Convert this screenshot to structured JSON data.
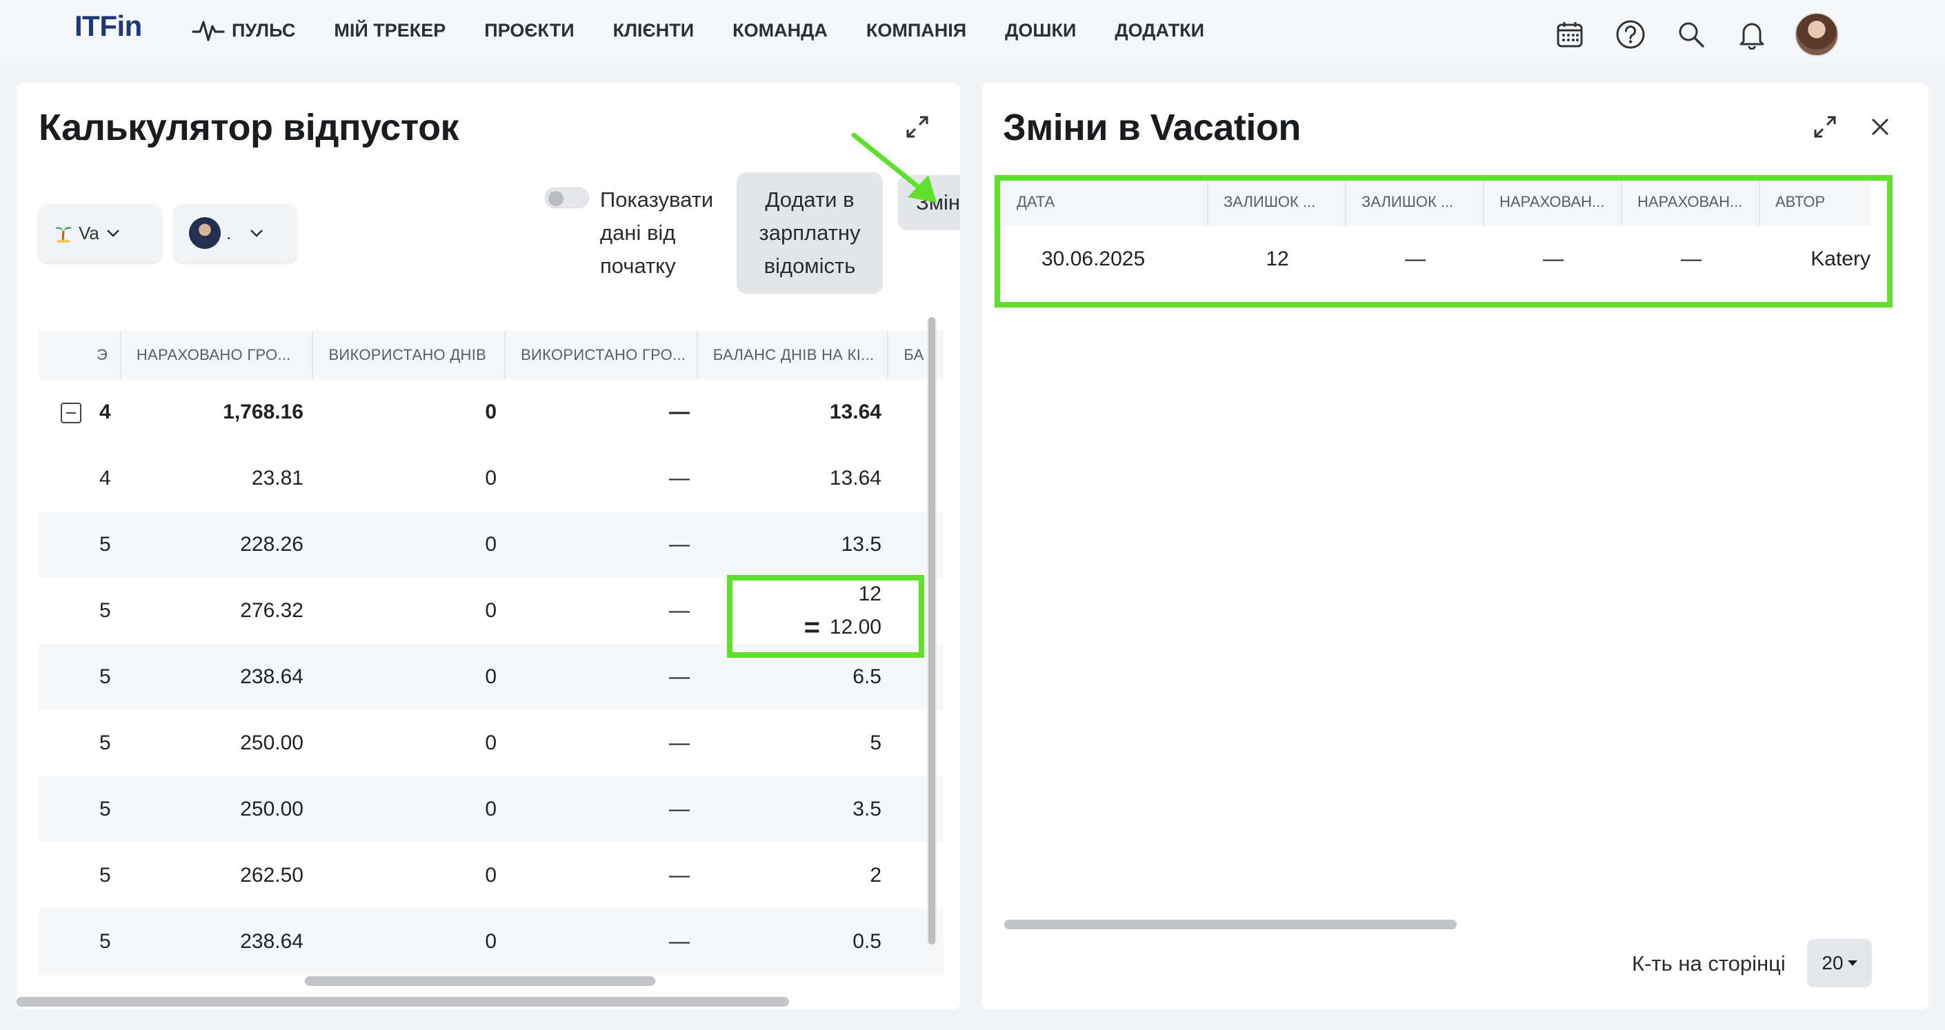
{
  "app": {
    "logo": "ITFin",
    "nav": [
      {
        "label": "ПУЛЬС",
        "icon": "pulse-icon"
      },
      {
        "label": "МІЙ ТРЕКЕР"
      },
      {
        "label": "ПРОЄКТИ"
      },
      {
        "label": "КЛІЄНТИ"
      },
      {
        "label": "КОМАНДА"
      },
      {
        "label": "КОМПАНІЯ"
      },
      {
        "label": "ДОШКИ"
      },
      {
        "label": "ДОДАТКИ"
      }
    ],
    "nav_icons": [
      "calendar-icon",
      "help-icon",
      "search-icon",
      "bell-icon"
    ]
  },
  "left_panel": {
    "title": "Калькулятор відпусток",
    "filter_type": "Va",
    "filter_user": ".",
    "toggle_label": "Показувати дані від початку",
    "btn_payroll": "Додати в зарплатну відомість",
    "btn_changes": "Змін",
    "columns": [
      "Э",
      "НАРАХОВАНО ГРО...",
      "ВИКОРИСТАНО ДНІВ",
      "ВИКОРИСТАНО ГРО...",
      "БАЛАНС ДНІВ НА КІ...",
      "БА"
    ],
    "summary_row": {
      "c0": "4",
      "c1": "1,768.16",
      "c2": "0",
      "c3": "—",
      "c4": "13.64"
    },
    "rows": [
      {
        "c0": "4",
        "c1": "23.81",
        "c2": "0",
        "c3": "—",
        "c4": "13.64"
      },
      {
        "c0": "5",
        "c1": "228.26",
        "c2": "0",
        "c3": "—",
        "c4": "13.5"
      },
      {
        "c0": "5",
        "c1": "276.32",
        "c2": "0",
        "c3": "—",
        "c4_top": "12",
        "c4_bottom": "12.00",
        "c4_symbol": "="
      },
      {
        "c0": "5",
        "c1": "238.64",
        "c2": "0",
        "c3": "—",
        "c4": "6.5"
      },
      {
        "c0": "5",
        "c1": "250.00",
        "c2": "0",
        "c3": "—",
        "c4": "5"
      },
      {
        "c0": "5",
        "c1": "250.00",
        "c2": "0",
        "c3": "—",
        "c4": "3.5"
      },
      {
        "c0": "5",
        "c1": "262.50",
        "c2": "0",
        "c3": "—",
        "c4": "2"
      },
      {
        "c0": "5",
        "c1": "238.64",
        "c2": "0",
        "c3": "—",
        "c4": "0.5"
      }
    ]
  },
  "right_panel": {
    "title": "Зміни в Vacation",
    "columns": [
      "ДАТА",
      "ЗАЛИШОК ...",
      "ЗАЛИШОК ...",
      "НАРАХОВАН...",
      "НАРАХОВАН...",
      "АВТОР"
    ],
    "row": {
      "date": "30.06.2025",
      "rem1": "12",
      "rem2": "—",
      "acc1": "—",
      "acc2": "—",
      "author": "Katery"
    },
    "page_size_label": "К-ть на сторінці",
    "page_size": "20"
  },
  "colors": {
    "highlight": "#5fe02c",
    "logo": "#1a3a7a",
    "background": "#f3f4f7"
  }
}
